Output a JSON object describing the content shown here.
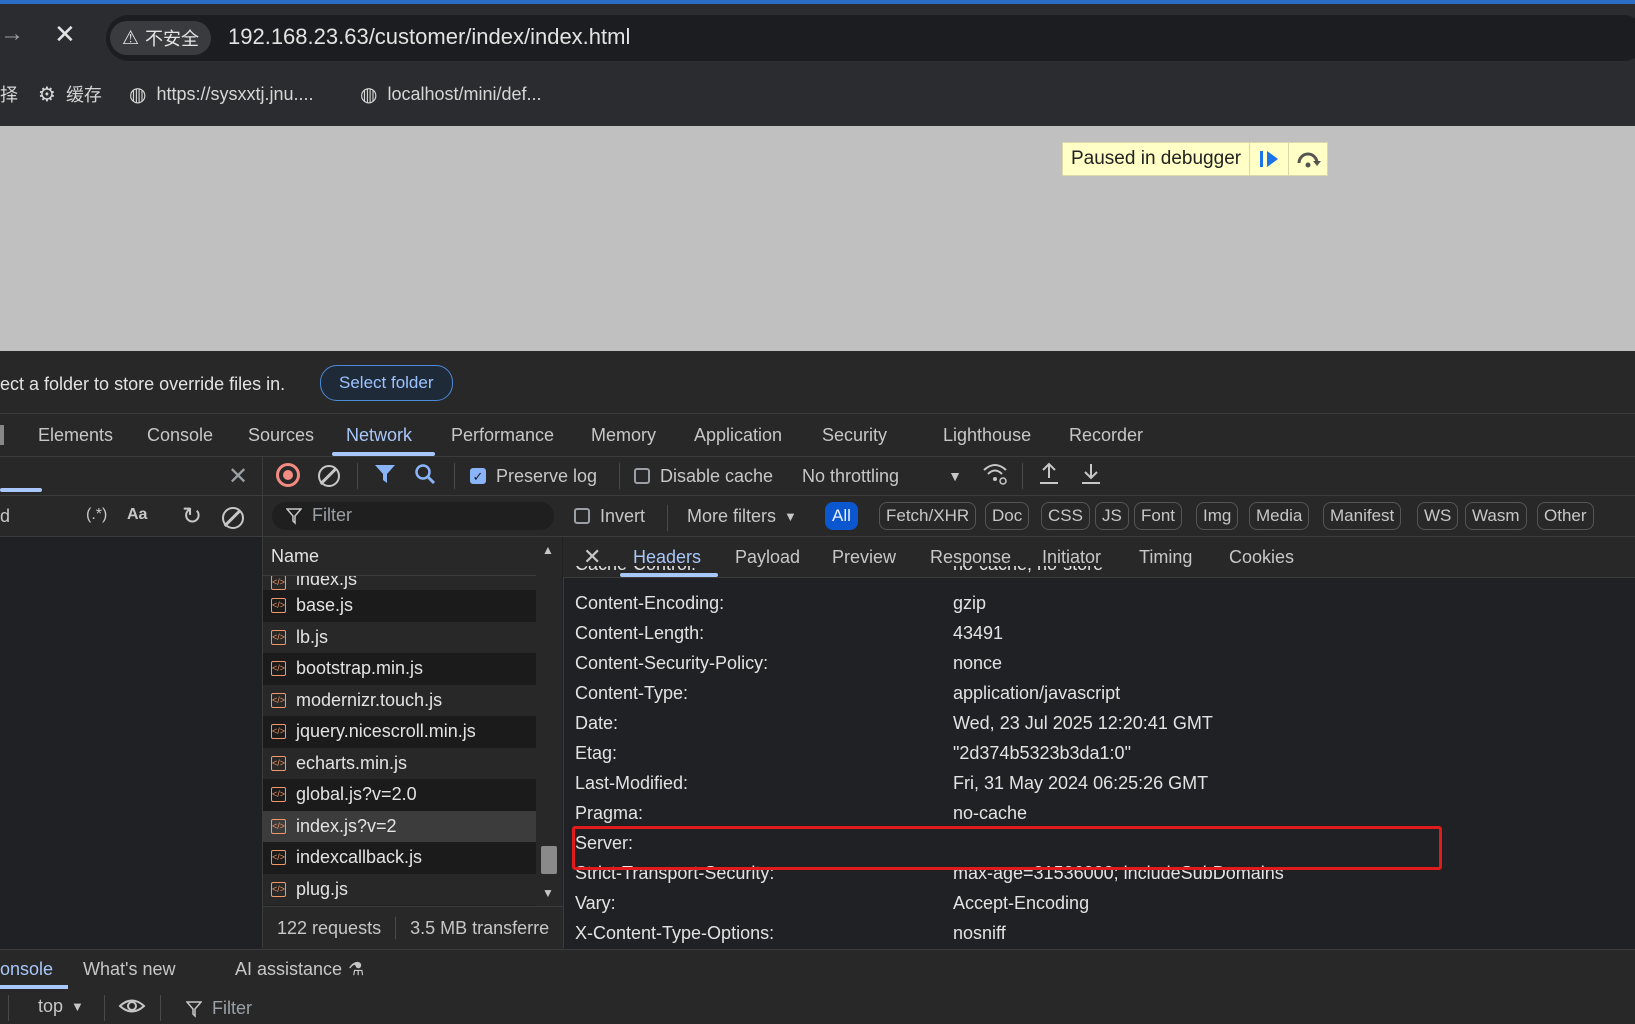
{
  "browser": {
    "url": "192.168.23.63/customer/index/index.html",
    "security_label": "不安全",
    "bookmarks": [
      {
        "label": "择",
        "icon": "none"
      },
      {
        "label": "缓存",
        "icon": "gear-icon"
      },
      {
        "label": "https://sysxxtj.jnu....",
        "icon": "globe-icon"
      },
      {
        "label": "localhost/mini/def...",
        "icon": "globe-icon"
      }
    ]
  },
  "page": {
    "paused_text": "Paused in debugger"
  },
  "overrides": {
    "text": "ect a folder to store override files in.",
    "button": "Select folder"
  },
  "devtools": {
    "tabs": [
      "Elements",
      "Console",
      "Sources",
      "Network",
      "Performance",
      "Memory",
      "Application",
      "Security",
      "Lighthouse",
      "Recorder"
    ],
    "active_tab": "Network"
  },
  "network": {
    "toolbar": {
      "preserve_log": "Preserve log",
      "disable_cache": "Disable cache",
      "throttling": "No throttling"
    },
    "left": {
      "regex": "(.*)",
      "match_case": "Aa",
      "stub": "d"
    },
    "filter": {
      "placeholder": "Filter",
      "invert": "Invert",
      "more_filters": "More filters",
      "types": [
        "All",
        "Fetch/XHR",
        "Doc",
        "CSS",
        "JS",
        "Font",
        "Img",
        "Media",
        "Manifest",
        "WS",
        "Wasm",
        "Other"
      ]
    },
    "list_header": "Name",
    "requests": [
      "index.js",
      "base.js",
      "lb.js",
      "bootstrap.min.js",
      "modernizr.touch.js",
      "jquery.nicescroll.min.js",
      "echarts.min.js",
      "global.js?v=2.0",
      "index.js?v=2",
      "indexcallback.js",
      "plug.js"
    ],
    "selected_request": "index.js?v=2",
    "summary": {
      "requests": "122 requests",
      "transferred": "3.5 MB transferre"
    }
  },
  "details": {
    "tabs": [
      "Headers",
      "Payload",
      "Preview",
      "Response",
      "Initiator",
      "Timing",
      "Cookies"
    ],
    "active_tab": "Headers",
    "headers": [
      {
        "name": "Cache-Control:",
        "value": "no-cache, no-store"
      },
      {
        "name": "Content-Encoding:",
        "value": "gzip"
      },
      {
        "name": "Content-Length:",
        "value": "43491"
      },
      {
        "name": "Content-Security-Policy:",
        "value": "nonce"
      },
      {
        "name": "Content-Type:",
        "value": "application/javascript"
      },
      {
        "name": "Date:",
        "value": "Wed, 23 Jul 2025 12:20:41 GMT"
      },
      {
        "name": "Etag:",
        "value": "\"2d374b5323b3da1:0\""
      },
      {
        "name": "Last-Modified:",
        "value": "Fri, 31 May 2024 06:25:26 GMT"
      },
      {
        "name": "Pragma:",
        "value": "no-cache"
      },
      {
        "name": "Server:",
        "value": ""
      },
      {
        "name": "Strict-Transport-Security:",
        "value": "max-age=31536000; includeSubDomains"
      },
      {
        "name": "Vary:",
        "value": "Accept-Encoding"
      },
      {
        "name": "X-Content-Type-Options:",
        "value": "nosniff"
      }
    ]
  },
  "drawer": {
    "tabs": [
      "onsole",
      "What's new",
      "AI assistance"
    ],
    "active_tab": "onsole",
    "context": "top",
    "filter_placeholder": "Filter"
  },
  "colors": {
    "accent": "#a8c7fa",
    "highlight_box": "#e01b1b",
    "paused_bg": "#ffffc6"
  }
}
